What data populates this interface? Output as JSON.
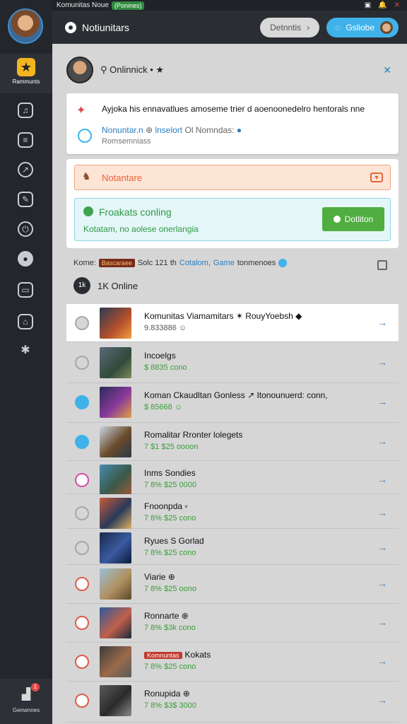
{
  "titlebar": {
    "title": "Komunitas Noue",
    "tag": "(Ponines)",
    "icons": [
      "window-icon",
      "bell-icon",
      "close-icon"
    ]
  },
  "sidebar": {
    "home_label": "Rammunts",
    "bottom_label": "Genwnnes",
    "badge": "1"
  },
  "header": {
    "title": "Notiunitars",
    "grey_button": "Detnntis",
    "blue_button": "Gsliobe"
  },
  "profile": {
    "name": "Onlinnick"
  },
  "notice": {
    "text": "Ayjoka his ennavatlues amoseme trier d aoenoonedelro hentorals nne",
    "line2_link": "Nonuntar.n",
    "line2_rest": "lnselort",
    "line2_tail": "Ol Nomndas:",
    "line3": "Romsemniass"
  },
  "alert_orange": {
    "text": "Notantare"
  },
  "alert_green": {
    "title": "Froakats conling",
    "sub": "Kotatam, no aolese onerlangia",
    "button": "Dotliton"
  },
  "list_head": {
    "prefix": "Kome:",
    "tag": "Bascaraee",
    "middle": "Solc 121 th",
    "blue": "Cotalom,",
    "blue2": "Game",
    "tail": "tonmenoes",
    "online_badge": "1k",
    "online_text": "1K Online"
  },
  "games": [
    {
      "title": "Komunitas Viamamitars  ✶ RouyYoebsh ◆",
      "price": "9.833886 ☺",
      "icon": "grey"
    },
    {
      "title": "Incoelgs",
      "price": "$ 8835 cono",
      "icon": "grey"
    },
    {
      "title": "Koman Ckaudltan Gonless  ↗ Itonounuerd: conn,",
      "price": "$ 85668 ☺",
      "icon": "blue"
    },
    {
      "title": "Romalitar Rronter lolegets",
      "price": "7 $1 $25 oooon",
      "icon": "blue"
    },
    {
      "title": "Inms Sondies",
      "price": "7 8% $25 0000",
      "icon": "pink"
    },
    {
      "title": "Fnoonpda ▫",
      "price": "7 8% $25 cono",
      "icon": "grey"
    },
    {
      "title": "Ryues S Gorlad",
      "price": "7 8% $25 cono",
      "icon": "grey"
    },
    {
      "title": "Viarie ⊕",
      "price": "7 8% $25 oono",
      "icon": "red"
    },
    {
      "title": "Ronnarte ⊕",
      "price": "7 8% $3k cono",
      "icon": "red"
    },
    {
      "title": "Kokats",
      "price": "7 8% $25 cono",
      "icon": "red",
      "tag": "Komnuntas"
    },
    {
      "title": "Ronupida ⊕",
      "price": "7 8% $3$ 3000",
      "icon": "red"
    }
  ]
}
